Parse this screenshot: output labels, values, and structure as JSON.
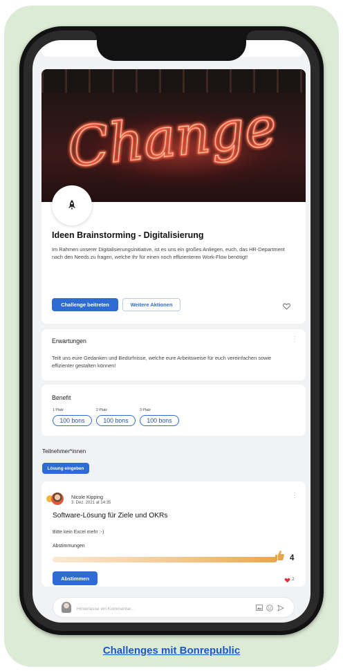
{
  "colors": {
    "accent": "#2e6cd4",
    "background_card": "#dcebd6",
    "progress_start": "#fbe9d3",
    "progress_end": "#eaa54f",
    "like_heart": "#d9363e",
    "caption_link": "#1d56c9"
  },
  "hero": {
    "image_text": "Change",
    "icon": "rocket-icon"
  },
  "challenge": {
    "title": "Ideen Brainstorming - Digitalisierung",
    "description": "Im Rahmen unserer Digitalisierungsinitiative, ist es uns ein großes Anliegen, euch, das HR-Department nach den Needs zu fragen, welche Ihr für einen noch effizienteren Work-Flow benötigt!",
    "join_button": "Challenge beitreten",
    "more_button": "Weitere Aktionen"
  },
  "expectations": {
    "title": "Erwartungen",
    "text": "Teilt uns eure Gedanken und Bedürfnisse, welche eure Arbeitsweise für euch vereinfachen sowie effizienter gestalten können!"
  },
  "benefit": {
    "title": "Benefit",
    "places": [
      {
        "label": "1 Platz",
        "reward": "100 bons"
      },
      {
        "label": "2 Platz",
        "reward": "100 bons"
      },
      {
        "label": "3 Platz",
        "reward": "100 bons"
      }
    ]
  },
  "participants": {
    "title": "Teilnehmer*innen",
    "submit_button": "Lösung eingeben"
  },
  "post": {
    "author": "Nicole Kipping",
    "date": "3. Dez. 2021 at 14:35",
    "title": "Software-Lösung für Ziele und OKRs",
    "text": "Bitte kein Excel mehr :-)",
    "votes_label": "Abstimmungen",
    "votes_count": "4",
    "vote_button": "Abstimmen",
    "likes": "2"
  },
  "comment": {
    "placeholder": "Hinterlasse ein Kommentar..."
  },
  "caption": "Challenges mit Bonrepublic"
}
